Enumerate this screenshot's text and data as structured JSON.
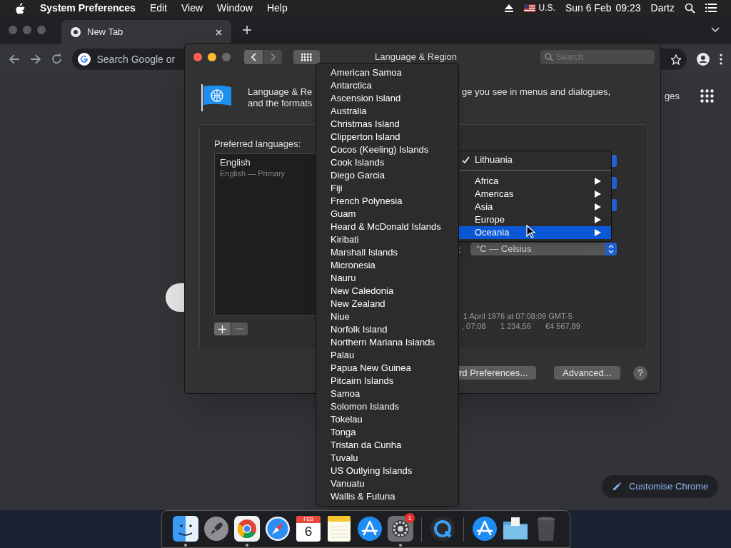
{
  "menu_bar": {
    "app": "System Preferences",
    "menus": [
      "Edit",
      "View",
      "Window",
      "Help"
    ],
    "input_source": "U.S.",
    "date": "Sun 6 Feb",
    "time": "09:23",
    "user": "Dartz"
  },
  "browser": {
    "tab": {
      "title": "New Tab",
      "selected": true
    },
    "omnibox_placeholder": "Search Google or",
    "apps_link": "ges",
    "customise_button": "Customise Chrome"
  },
  "prefs_window": {
    "title": "Language & Region",
    "search_placeholder": "Search",
    "intro_lines": [
      "Language & Re",
      "and the formats"
    ],
    "intro_right": "ge you see in menus and dialogues,",
    "preferred_label": "Preferred languages:",
    "languages": [
      {
        "name": "English",
        "detail": "English — Primary"
      }
    ],
    "temperature_label": ":",
    "temperature": "°C — Celsius",
    "sample_date": "1 April 1976 at 07:08:09 GMT-5",
    "sample_time": ", 07:08",
    "sample_number": "1 234,56",
    "sample_currency": "€4 567,89",
    "buttons": [
      "rd Preferences...",
      "Advanced..."
    ],
    "help": "?"
  },
  "region_menu": {
    "items": [
      {
        "kind": "check",
        "label": "Lithuania",
        "checked": true
      },
      {
        "kind": "separator"
      },
      {
        "kind": "submenu",
        "label": "Africa",
        "selected": false
      },
      {
        "kind": "submenu",
        "label": "Americas",
        "selected": false
      },
      {
        "kind": "submenu",
        "label": "Asia",
        "selected": false
      },
      {
        "kind": "submenu",
        "label": "Europe",
        "selected": false
      },
      {
        "kind": "submenu",
        "label": "Oceania",
        "selected": true
      }
    ]
  },
  "country_menu": {
    "items": [
      "American Samoa",
      "Antarctica",
      "Ascension Island",
      "Australia",
      "Christmas Island",
      "Clipperton Island",
      "Cocos (Keeling) Islands",
      "Cook Islands",
      "Diego Garcia",
      "Fiji",
      "French Polynesia",
      "Guam",
      "Heard & McDonald Islands",
      "Kiribati",
      "Marshall Islands",
      "Micronesia",
      "Nauru",
      "New Caledonia",
      "New Zealand",
      "Niue",
      "Norfolk Island",
      "Northern Mariana Islands",
      "Palau",
      "Papua New Guinea",
      "Pitcairn Islands",
      "Samoa",
      "Solomon Islands",
      "Tokelau",
      "Tonga",
      "Tristan da Cunha",
      "Tuvalu",
      "US Outlying Islands",
      "Vanuatu",
      "Wallis & Futuna"
    ]
  },
  "dock": {
    "items": [
      {
        "kind": "finder",
        "running": true
      },
      {
        "kind": "rocket",
        "running": false
      },
      {
        "kind": "chrome",
        "running": true
      },
      {
        "kind": "compass",
        "running": false
      },
      {
        "kind": "calendar",
        "month": "FEB",
        "day": "6",
        "running": false
      },
      {
        "kind": "notes",
        "running": false
      },
      {
        "kind": "appstore",
        "running": false
      },
      {
        "kind": "settings",
        "badge": "1",
        "running": true
      },
      {
        "kind": "divider"
      },
      {
        "kind": "quicktime",
        "running": false
      },
      {
        "kind": "divider"
      },
      {
        "kind": "appstore",
        "running": false
      },
      {
        "kind": "folder",
        "running": false
      },
      {
        "kind": "trash",
        "running": false
      }
    ]
  }
}
